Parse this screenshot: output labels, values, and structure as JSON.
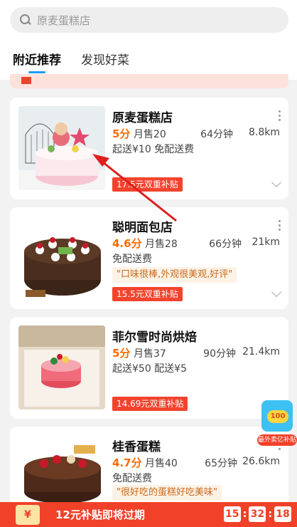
{
  "search": {
    "placeholder": "原麦蛋糕店"
  },
  "tabs": [
    {
      "label": "附近推荐",
      "active": true
    },
    {
      "label": "发现好菜",
      "active": false
    }
  ],
  "stores": [
    {
      "name": "原麦蛋糕店",
      "rating": "5分",
      "sales": "月售20",
      "eta": "64分钟",
      "distance": "8.8km",
      "delivery_line": "起送¥10  免配送费",
      "promo": "17.5元双重补贴"
    },
    {
      "name": "聪明面包店",
      "rating": "4.6分",
      "sales": "月售28",
      "eta": "66分钟",
      "distance": "21km",
      "delivery_line": "免配送费",
      "quote": "\"口味很棒,外观很美观,好评\"",
      "promo": "15.5元双重补贴"
    },
    {
      "name": "菲尔雪时尚烘焙",
      "rating": "5分",
      "sales": "月售37",
      "eta": "90分钟",
      "distance": "21.4km",
      "delivery_line": "起送¥50  配送¥5",
      "promo": "14.69元双重补贴"
    },
    {
      "name": "桂香蛋糕",
      "rating": "4.7分",
      "sales": "月售40",
      "eta": "65分钟",
      "distance": "26.6km",
      "delivery_line": "免配送费",
      "quote": "\"很好吃的蛋糕好吃美味\""
    }
  ],
  "bottom_bar": {
    "coupon_symbol": "¥",
    "message": "12元补贴即将过期",
    "timer": [
      "15",
      "32",
      "18"
    ]
  },
  "floating_badge": {
    "value": "100",
    "label": "最外卖亿补贴"
  },
  "colors": {
    "accent": "#1a9cf4",
    "promo_red": "#f3432d",
    "rating_orange": "#ff6a00"
  }
}
